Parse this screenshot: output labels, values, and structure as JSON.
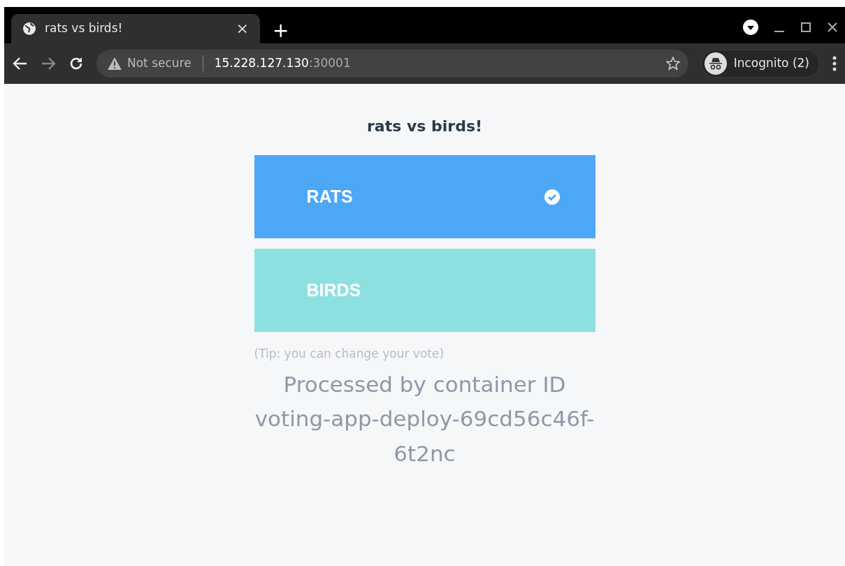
{
  "browser": {
    "tab": {
      "title": "rats vs birds!",
      "close": "×"
    },
    "new_tab": "+",
    "address": {
      "security": "Not secure",
      "host": "15.228.127.130",
      "port": ":30001"
    },
    "profile": "Incognito (2)"
  },
  "page": {
    "title": "rats vs birds!",
    "options": [
      {
        "label": "RATS",
        "color": "#4ca8f7",
        "selected": true
      },
      {
        "label": "BIRDS",
        "color": "#8de0e0",
        "selected": false
      }
    ],
    "tip": "(Tip: you can change your vote)",
    "container_info": "Processed by container ID voting-app-deploy-69cd56c46f-6t2nc"
  }
}
